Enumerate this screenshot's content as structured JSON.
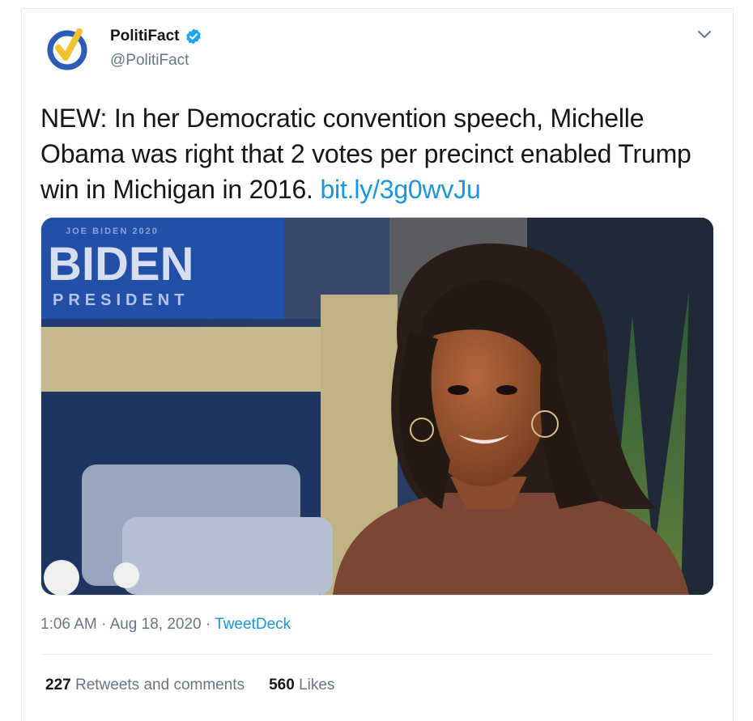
{
  "tweet": {
    "display_name": "PolitiFact",
    "handle": "@PolitiFact",
    "verified": true,
    "text": "NEW: In her Democratic convention speech, Michelle Obama was right that 2 votes per precinct enabled Trump win in Michigan in 2016. ",
    "link_text": "bit.ly/3g0wvJu",
    "time": "1:06 AM",
    "separator": "·",
    "date": "Aug 18, 2020",
    "source": "TweetDeck",
    "retweets_count": "227",
    "retweets_label": "Retweets and comments",
    "likes_count": "560",
    "likes_label": "Likes"
  },
  "media": {
    "sign_line1": "BIDEN",
    "sign_line2": "PRESIDENT",
    "sign_top": "JOE BIDEN 2020"
  },
  "colors": {
    "link": "#1b95e0",
    "verified": "#1da1f2",
    "secondary_text": "#657786",
    "sign_blue": "#2250a8",
    "sign_red": "#d0303a"
  },
  "icons": [
    "politifact-logo",
    "verified-badge-icon",
    "chevron-down-icon"
  ]
}
